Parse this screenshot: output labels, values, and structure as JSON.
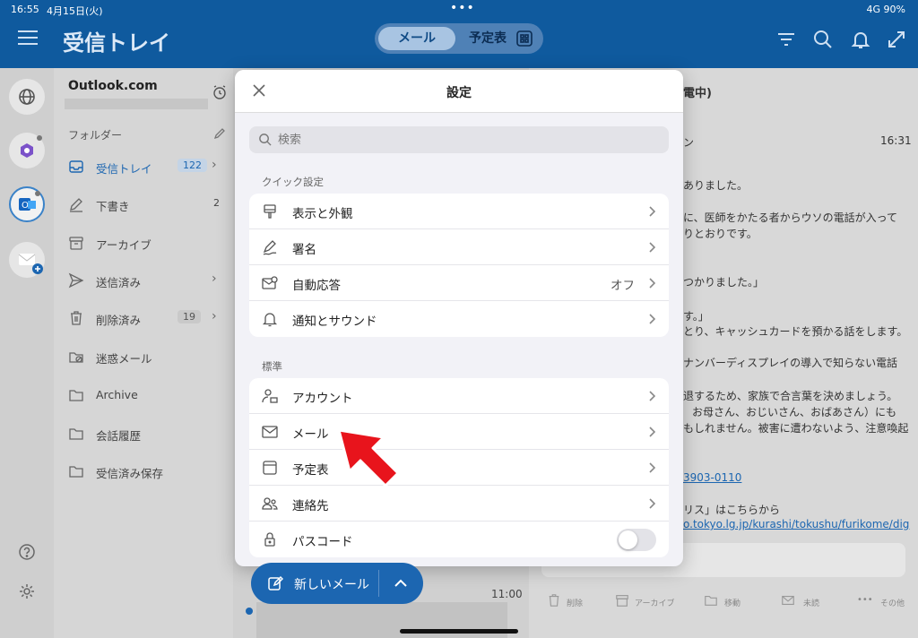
{
  "status_bar": {
    "time": "16:55",
    "date": "4月15日(火)",
    "right": "4G 90%"
  },
  "header": {
    "title": "受信トレイ",
    "seg_mail": "メール",
    "seg_calendar": "予定表"
  },
  "account": {
    "name": "Outlook.com"
  },
  "folders": {
    "heading": "フォルダー",
    "items": [
      {
        "label": "受信トレイ",
        "count": "122"
      },
      {
        "label": "下書き",
        "count": "2"
      },
      {
        "label": "アーカイブ",
        "count": ""
      },
      {
        "label": "送信済み",
        "count": ""
      },
      {
        "label": "削除済み",
        "count": "19"
      },
      {
        "label": "迷惑メール",
        "count": ""
      },
      {
        "label": "Archive",
        "count": ""
      },
      {
        "label": "会話履歴",
        "count": ""
      },
      {
        "label": "受信済み保存",
        "count": ""
      }
    ]
  },
  "reader": {
    "subject_tail": "電中)",
    "sender_tail": "ン",
    "time": "16:31",
    "lines": [
      "ありました。",
      "に、医師をかたる者からウソの電話が入って",
      "りとおりです。",
      "つかりました。」",
      "す。」",
      "とり、キャッシュカードを預かる話をします。",
      "ナンバーディスプレイの導入で知らない電話",
      "退するため、家族で合言葉を決めましょう。",
      "お母さん、おじいさん、おばあさん）にも",
      "もしれません。被害に遭わないよう、注意喚起",
      "3903-0110",
      "リス」はこちらから",
      "o.tokyo.lg.jp/kurashi/tokushu/furikome/dig"
    ],
    "toolbar": [
      "削除",
      "アーカイブ",
      "移動",
      "未読",
      "その他"
    ]
  },
  "list": {
    "time": "11:00"
  },
  "settings": {
    "title": "設定",
    "search_placeholder": "検索",
    "quick_heading": "クイック設定",
    "quick": [
      {
        "label": "表示と外観",
        "value": ""
      },
      {
        "label": "署名",
        "value": ""
      },
      {
        "label": "自動応答",
        "value": "オフ"
      },
      {
        "label": "通知とサウンド",
        "value": ""
      }
    ],
    "standard_heading": "標準",
    "standard": [
      {
        "label": "アカウント"
      },
      {
        "label": "メール"
      },
      {
        "label": "予定表"
      },
      {
        "label": "連絡先"
      },
      {
        "label": "パスコード"
      }
    ]
  },
  "fab": {
    "label": "新しいメール"
  },
  "colors": {
    "brand": "#0f5a9e",
    "accent": "#1c66b1",
    "arrow": "#e8141c"
  }
}
